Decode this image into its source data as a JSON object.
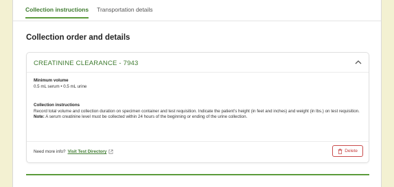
{
  "tabs": [
    {
      "label": "Collection instructions",
      "active": true
    },
    {
      "label": "Transportation details",
      "active": false
    }
  ],
  "section": {
    "title": "Collection order and details"
  },
  "test": {
    "title": "CREATININE CLEARANCE - 7943",
    "min_volume_label": "Minimum volume",
    "min_volume_value": "0.5 mL serum • 0.5 mL urine",
    "instructions_label": "Collection instructions",
    "instructions_text": "Record total volume and collection duration on specimen container and test requisition. Indicate the patient's height (in feet and inches) and weight (in lbs.) on test requisition.",
    "note_label": "Note:",
    "note_text": " A serum creatinine level must be collected within 24 hours of the beginning or ending of the urine collection.",
    "more_info_text": "Need more info?",
    "more_info_link": "Visit Test Directory",
    "delete_label": "Delete"
  },
  "colors": {
    "accent_green": "#3d7a2e",
    "delete_red": "#c43c3c",
    "background": "#f3f1d2"
  },
  "icons": {
    "chevron": "chevron-up-icon",
    "external": "external-link-icon",
    "delete": "trash-icon"
  }
}
